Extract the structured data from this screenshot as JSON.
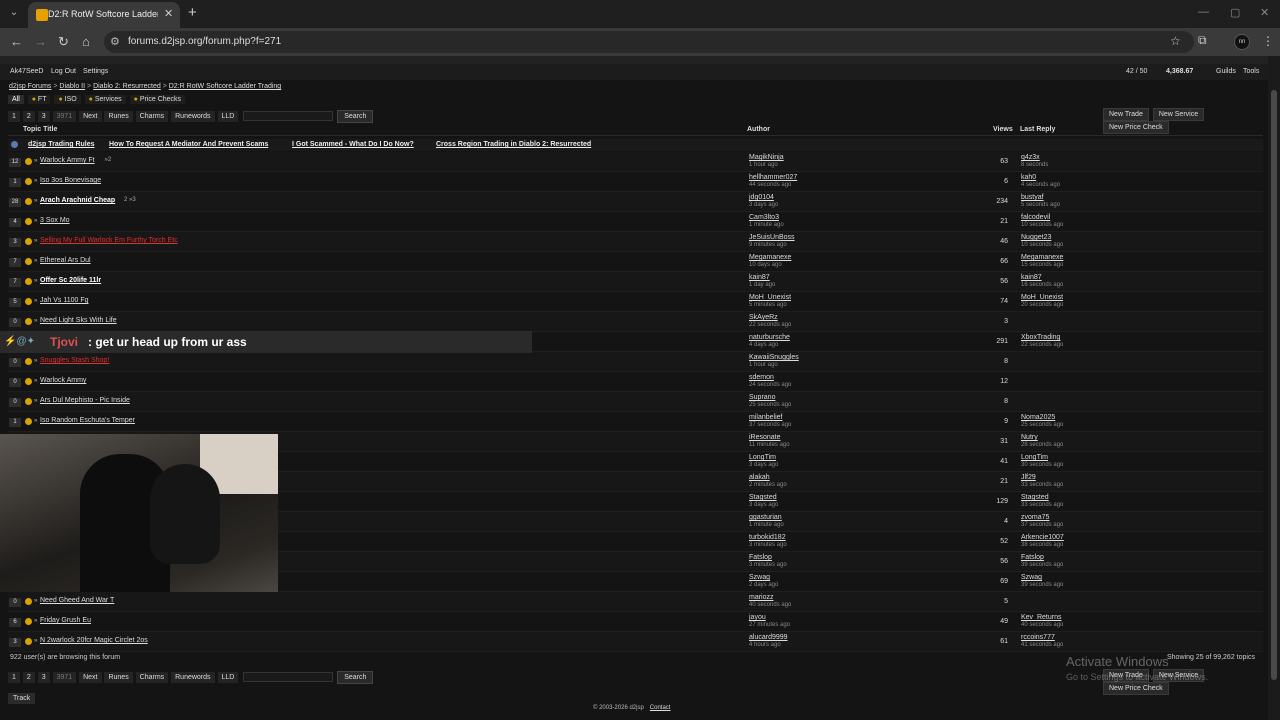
{
  "browser": {
    "tab_title": "D2:R RotW Softcore Ladder Tra...",
    "url": "forums.d2jsp.org/forum.php?f=271",
    "profile": "nn"
  },
  "userbar": {
    "username": "Ak47SeeD",
    "logout": "Log Out",
    "settings": "Settings",
    "pm": "42 / 50",
    "gold": "4,368.67",
    "guilds": "Guilds",
    "tools": "Tools"
  },
  "breadcrumb": [
    "d2jsp Forums",
    "Diablo II",
    "Diablo 2: Resurrected",
    "D2:R RotW Softcore Ladder Trading"
  ],
  "categories": [
    "All",
    "FT",
    "ISO",
    "Services",
    "Price Checks"
  ],
  "pager": {
    "pages": [
      "1",
      "2",
      "3"
    ],
    "last": "3971",
    "next": "Next",
    "links": [
      "Runes",
      "Charms",
      "Runewords",
      "LLD"
    ],
    "search": "Search"
  },
  "actions": [
    "New Trade",
    "New Service",
    "New Price Check"
  ],
  "table_headers": {
    "title": "Topic Title",
    "author": "Author",
    "views": "Views",
    "last": "Last Reply"
  },
  "stickies": [
    "d2jsp Trading Rules",
    "How To Request A Mediator And Prevent Scams",
    "I Got Scammed - What Do I Do Now?",
    "Cross Region Trading in Diablo 2: Resurrected"
  ],
  "rows": [
    {
      "count": "12",
      "title": "Warlock Ammy Ft",
      "pages": "»2",
      "author": "MagikNinja",
      "atime": "1 hour ago",
      "views": "63",
      "last": "q4z3x",
      "ltime": "8 seconds"
    },
    {
      "count": "1",
      "title": "Iso 3os Bonevisage",
      "author": "hellhammer027",
      "atime": "44 seconds ago",
      "views": "6",
      "last": "kah0",
      "ltime": "4 seconds ago"
    },
    {
      "count": "28",
      "title": "Arach Arachnid Cheap",
      "pages": "2 »3",
      "bold": true,
      "author": "jdg0104",
      "atime": "3 days ago",
      "views": "234",
      "last": "bustyaf",
      "ltime": "5 seconds ago"
    },
    {
      "count": "4",
      "title": "3 Sox Mo",
      "author": "Cam3lto3",
      "atime": "1 minute ago",
      "views": "21",
      "last": "falcodevil",
      "ltime": "10 seconds ago"
    },
    {
      "count": "3",
      "title": "Selling My Full Warlock Em Furthy Torch Etc",
      "red": true,
      "author": "JeSuisUnBoss",
      "atime": "9 minutes ago",
      "views": "46",
      "last": "Nugget23",
      "ltime": "10 seconds ago"
    },
    {
      "count": "7",
      "title": "Ethereal Ars Dul",
      "author": "Megamanexe",
      "atime": "10 days ago",
      "views": "66",
      "last": "Megamanexe",
      "ltime": "15 seconds ago"
    },
    {
      "count": "7",
      "title": "Offer Sc 20life 11lr",
      "bold": true,
      "author": "kain87",
      "atime": "1 day ago",
      "views": "56",
      "last": "kain87",
      "ltime": "16 seconds ago"
    },
    {
      "count": "5",
      "title": "Jah Vs 1100 Fg",
      "author": "MoH_Unexist",
      "atime": "5 minutes ago",
      "views": "74",
      "last": "MoH_Unexist",
      "ltime": "20 seconds ago"
    },
    {
      "count": "0",
      "title": "Need Light Sks With Life",
      "author": "SkAyeRz",
      "atime": "22 seconds ago",
      "views": "3",
      "last": "",
      "ltime": ""
    },
    {
      "count": "",
      "title": "",
      "author": "naturbursche",
      "atime": "4 days ago",
      "views": "291",
      "last": "XboxTrading",
      "ltime": "22 seconds ago"
    },
    {
      "count": "0",
      "title": "Snuggles Stash Shop!",
      "red": true,
      "author": "KawaiiSnuggles",
      "atime": "1 hour ago",
      "views": "8",
      "last": "",
      "ltime": ""
    },
    {
      "count": "0",
      "title": "Warlock Ammy",
      "author": "sdemon",
      "atime": "24 seconds ago",
      "views": "12",
      "last": "",
      "ltime": ""
    },
    {
      "count": "0",
      "title": "Ars Dul Mephisto - Pic Inside",
      "author": "Suprano",
      "atime": "25 seconds ago",
      "views": "8",
      "last": "",
      "ltime": ""
    },
    {
      "count": "1",
      "title": "Iso Random Eschuta's Temper",
      "author": "milanbelief",
      "atime": "37 seconds ago",
      "views": "9",
      "last": "Noma2025",
      "ltime": "25 seconds ago"
    },
    {
      "count": "",
      "title": "",
      "author": "iResonate",
      "atime": "11 minutes ago",
      "views": "31",
      "last": "Nutry",
      "ltime": "28 seconds ago"
    },
    {
      "count": "",
      "title": "",
      "author": "LongTim",
      "atime": "3 days ago",
      "views": "41",
      "last": "LongTim",
      "ltime": "30 seconds ago"
    },
    {
      "count": "",
      "title": "",
      "author": "alakah",
      "atime": "2 minutes ago",
      "views": "21",
      "last": "Jlf29",
      "ltime": "33 seconds ago"
    },
    {
      "count": "",
      "title": "",
      "author": "Stagsted",
      "atime": "3 days ago",
      "views": "129",
      "last": "Stagsted",
      "ltime": "33 seconds ago"
    },
    {
      "count": "",
      "title": "",
      "author": "ggasturian",
      "atime": "1 minute ago",
      "views": "4",
      "last": "zvoma75",
      "ltime": "37 seconds ago"
    },
    {
      "count": "",
      "title": "",
      "author": "turbokid182",
      "atime": "3 minutes ago",
      "views": "52",
      "last": "Arkencie1007",
      "ltime": "38 seconds ago"
    },
    {
      "count": "",
      "title": "",
      "author": "Fatslop",
      "atime": "3 minutes ago",
      "views": "56",
      "last": "Fatslop",
      "ltime": "39 seconds ago"
    },
    {
      "count": "",
      "title": "",
      "author": "Szwag",
      "atime": "2 days ago",
      "views": "69",
      "last": "Szwag",
      "ltime": "39 seconds ago"
    },
    {
      "count": "0",
      "title": "Need Gheed And War T",
      "author": "mariozz",
      "atime": "40 seconds ago",
      "views": "5",
      "last": "",
      "ltime": ""
    },
    {
      "count": "6",
      "title": "Friday Grush Eu",
      "author": "jayou",
      "atime": "27 minutes ago",
      "views": "49",
      "last": "Kev_Returns",
      "ltime": "40 seconds ago"
    },
    {
      "count": "3",
      "title": "N 2warlock 20fcr Magic Circlet 2os",
      "author": "alucard9999",
      "atime": "4 hours ago",
      "views": "61",
      "last": "rccoins777",
      "ltime": "41 seconds ago"
    }
  ],
  "footer": {
    "browsing": "922 user(s) are browsing this forum",
    "showing": "Showing 25 of 99,262 topics",
    "track": "Track",
    "copyright": "© 2003-2026 d2jsp",
    "contact": "Contact"
  },
  "chat": {
    "badges": "⚡@✦",
    "name": "Tjovi",
    "message": ": get ur head up from ur ass"
  },
  "watermark": {
    "title": "Activate Windows",
    "sub": "Go to Settings to activate Windows."
  }
}
